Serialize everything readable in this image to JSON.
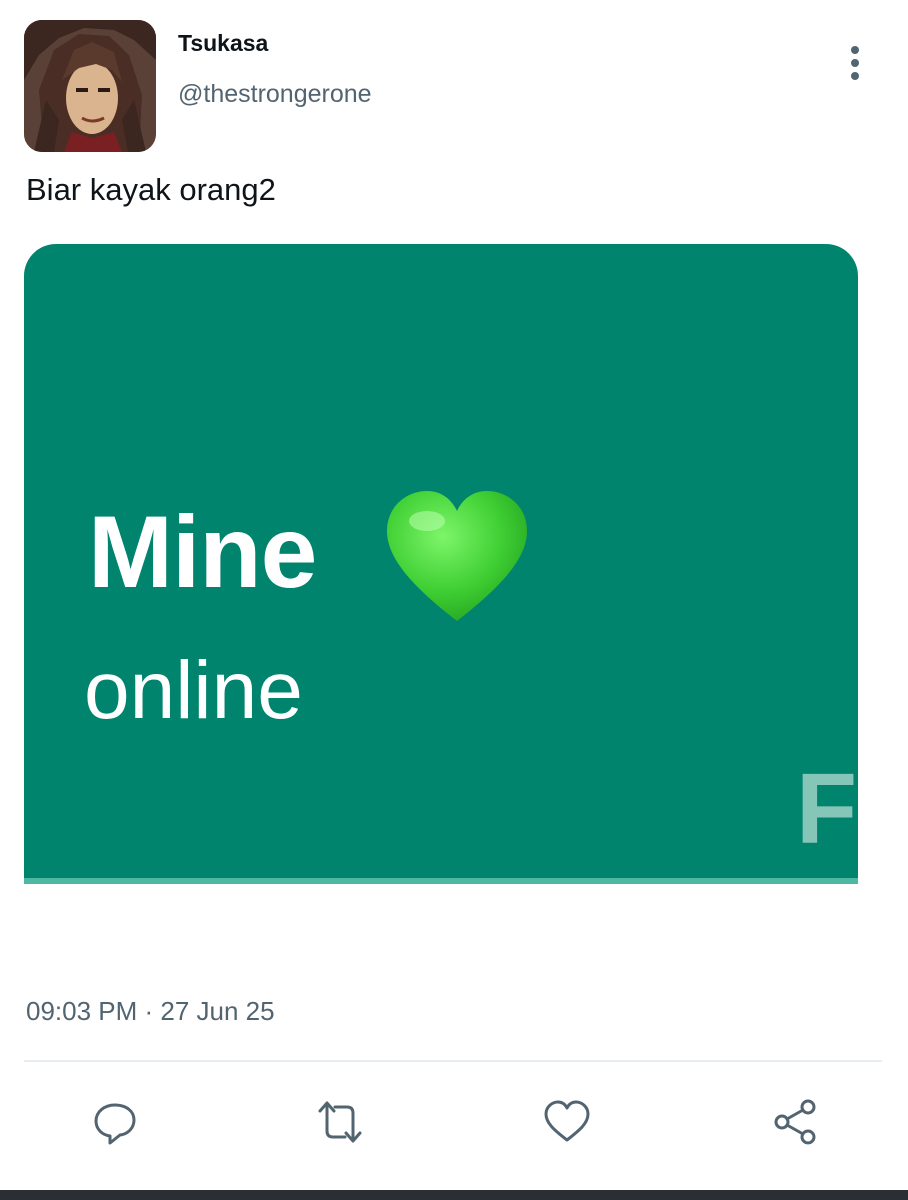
{
  "tweet": {
    "author": {
      "display_name": "Tsukasa",
      "handle": "@thestrongerone",
      "avatar_icon": "avatar-image"
    },
    "text": "Biar kayak orang2",
    "media": {
      "title": "Mine",
      "emoji": "green-heart-icon",
      "subtitle": "online",
      "partial_letter": "F",
      "background_color": "#00846e",
      "heart_color": "#3fcf33"
    },
    "timestamp": "09:03 PM · 27 Jun 25"
  },
  "menu": {
    "icon": "more-vertical-icon"
  },
  "actions": [
    {
      "name": "reply",
      "icon": "reply-icon"
    },
    {
      "name": "retweet",
      "icon": "retweet-icon"
    },
    {
      "name": "like",
      "icon": "heart-icon"
    },
    {
      "name": "share",
      "icon": "share-icon"
    }
  ],
  "colors": {
    "text_primary": "#0f1419",
    "text_secondary": "#536471",
    "divider": "#e6ecf0"
  }
}
